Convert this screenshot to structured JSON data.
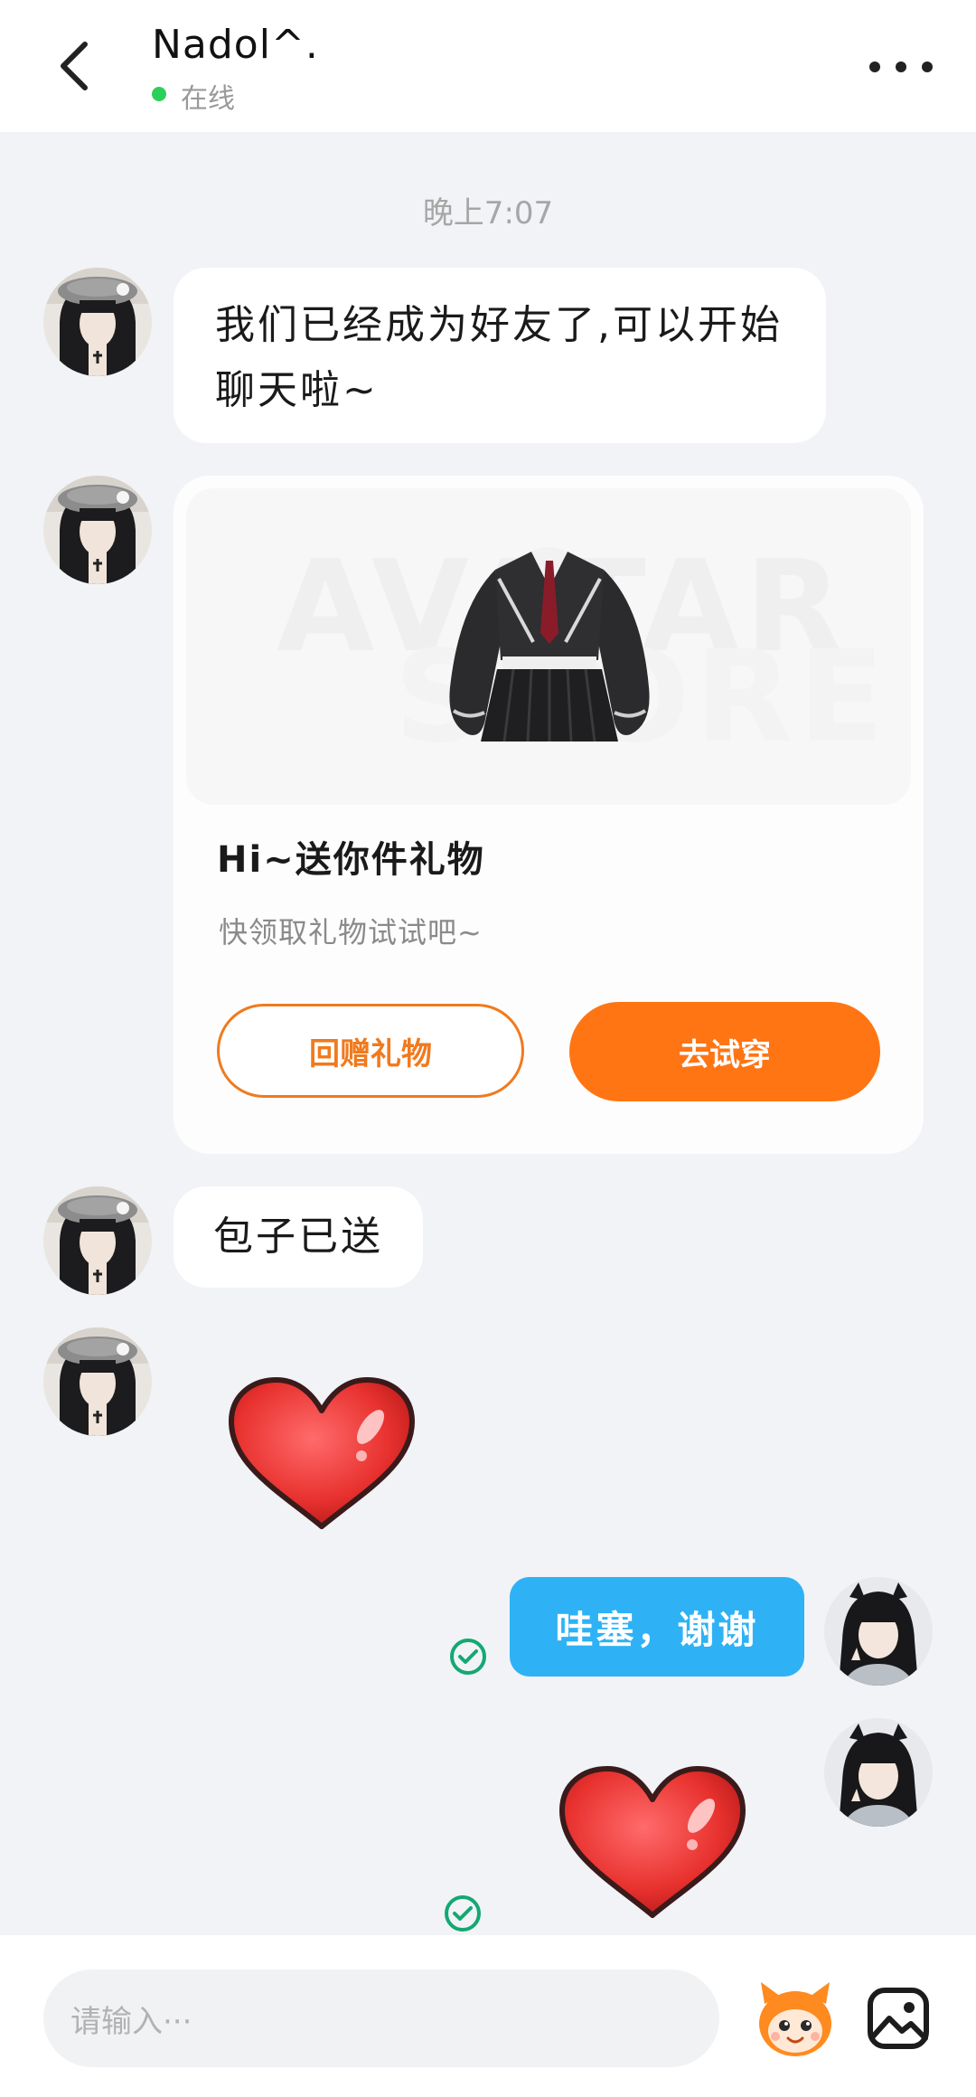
{
  "header": {
    "contact_name": "Nadol^.",
    "status": "在线"
  },
  "chat": {
    "timestamp": "晚上7:07",
    "messages": [
      {
        "type": "text",
        "from": "contact",
        "lines": [
          "我们已经成为好友了,可以开始",
          "聊天啦~"
        ]
      },
      {
        "type": "gift",
        "from": "contact",
        "title": "Hi~送你件礼物",
        "subtitle": "快领取礼物试试吧~",
        "button_return": "回赠礼物",
        "button_try": "去试穿",
        "watermark_line1": "AVATAR",
        "watermark_line2": "STORE"
      },
      {
        "type": "text",
        "from": "contact",
        "text": "包子已送"
      },
      {
        "type": "sticker",
        "from": "contact",
        "icon": "heart-sticker"
      },
      {
        "type": "text",
        "from": "me",
        "text": "哇塞，谢谢",
        "status": "read"
      },
      {
        "type": "sticker",
        "from": "me",
        "icon": "heart-sticker",
        "status": "read"
      }
    ]
  },
  "input": {
    "placeholder": "请输入···"
  },
  "colors": {
    "accent_orange": "#ff7514",
    "sent_bubble": "#2eb2f5",
    "online_green": "#2bcf5a",
    "read_check": "#14a873"
  }
}
